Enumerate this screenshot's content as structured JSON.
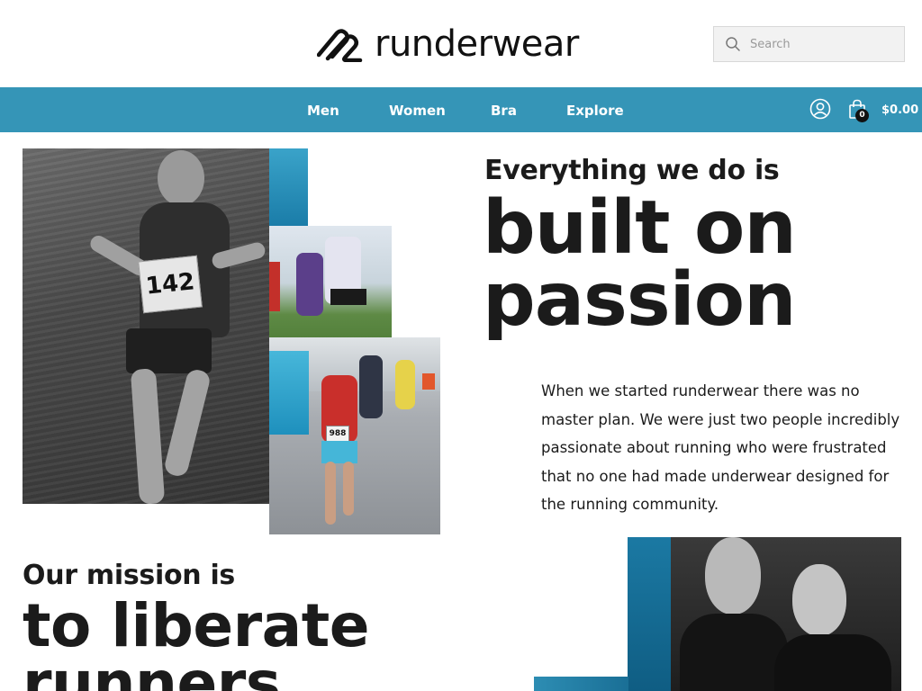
{
  "header": {
    "brand": "runderwear",
    "search": {
      "placeholder": "Search",
      "value": ""
    }
  },
  "nav": {
    "items": [
      {
        "label": "Men"
      },
      {
        "label": "Women"
      },
      {
        "label": "Bra"
      },
      {
        "label": "Explore"
      }
    ],
    "account_icon": "user-circle-icon",
    "cart_icon": "shopping-bag-icon",
    "cart_count": "0",
    "cart_total": "$0.00",
    "bar_color": "#3595b7"
  },
  "hero": {
    "lead_small": "Everything we do is",
    "lead_big_line1": "built on",
    "lead_big_line2": "passion",
    "paragraph": "When we started runderwear there was no master plan. We were just two people incredibly passionate about running who were frustrated that no one had made underwear designed for the running community."
  },
  "mission": {
    "small": "Our mission is",
    "big_line1": "to liberate",
    "big_line2": "runners"
  },
  "images": {
    "boy_bib": "142",
    "runner_bib": "988"
  }
}
